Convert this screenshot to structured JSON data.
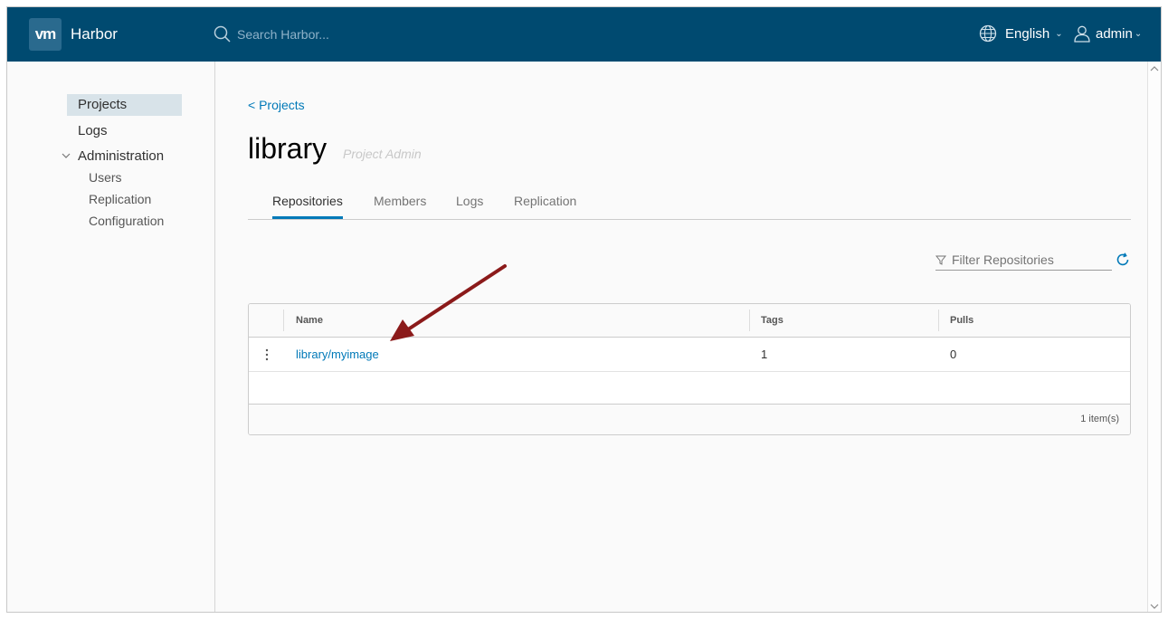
{
  "header": {
    "logo_text": "vm",
    "app_name": "Harbor",
    "search_placeholder": "Search Harbor...",
    "language": "English",
    "user": "admin"
  },
  "sidebar": {
    "items": [
      {
        "label": "Projects",
        "active": true
      },
      {
        "label": "Logs"
      },
      {
        "label": "Administration",
        "children": [
          {
            "label": "Users"
          },
          {
            "label": "Replication"
          },
          {
            "label": "Configuration"
          }
        ]
      }
    ]
  },
  "main": {
    "breadcrumb": "< Projects",
    "title": "library",
    "role": "Project Admin",
    "tabs": [
      {
        "label": "Repositories",
        "active": true
      },
      {
        "label": "Members"
      },
      {
        "label": "Logs"
      },
      {
        "label": "Replication"
      }
    ],
    "filter_placeholder": "Filter Repositories",
    "table": {
      "columns": [
        "Name",
        "Tags",
        "Pulls"
      ],
      "rows": [
        {
          "name": "library/myimage",
          "tags": "1",
          "pulls": "0"
        }
      ],
      "footer": "1 item(s)"
    }
  },
  "colors": {
    "header_bg": "#004a70",
    "accent": "#0079b8",
    "annotation_arrow": "#8b1a1a"
  }
}
